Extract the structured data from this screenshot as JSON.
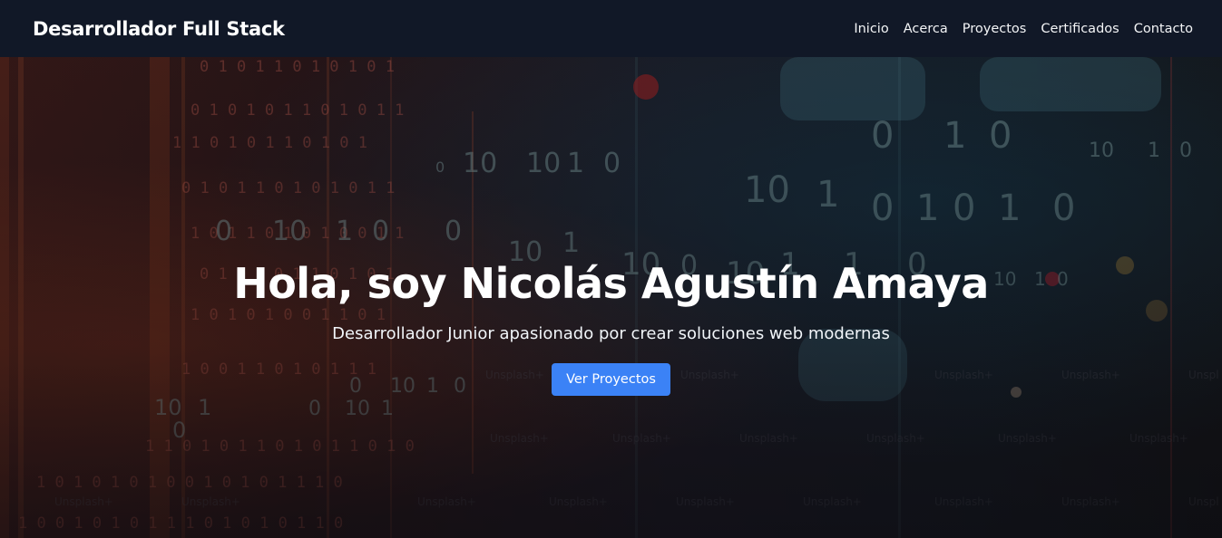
{
  "navbar": {
    "brand": "Desarrollador Full Stack",
    "links": [
      "Inicio",
      "Acerca",
      "Proyectos",
      "Certificados",
      "Contacto"
    ]
  },
  "hero": {
    "title": "Hola, soy Nicolás Agustín Amaya",
    "subtitle": "Desarrollador Junior apasionado por crear soluciones web modernas",
    "cta_label": "Ver Proyectos"
  },
  "colors": {
    "navbar_bg": "#111827",
    "accent": "#3b82f6",
    "text": "#ffffff"
  }
}
